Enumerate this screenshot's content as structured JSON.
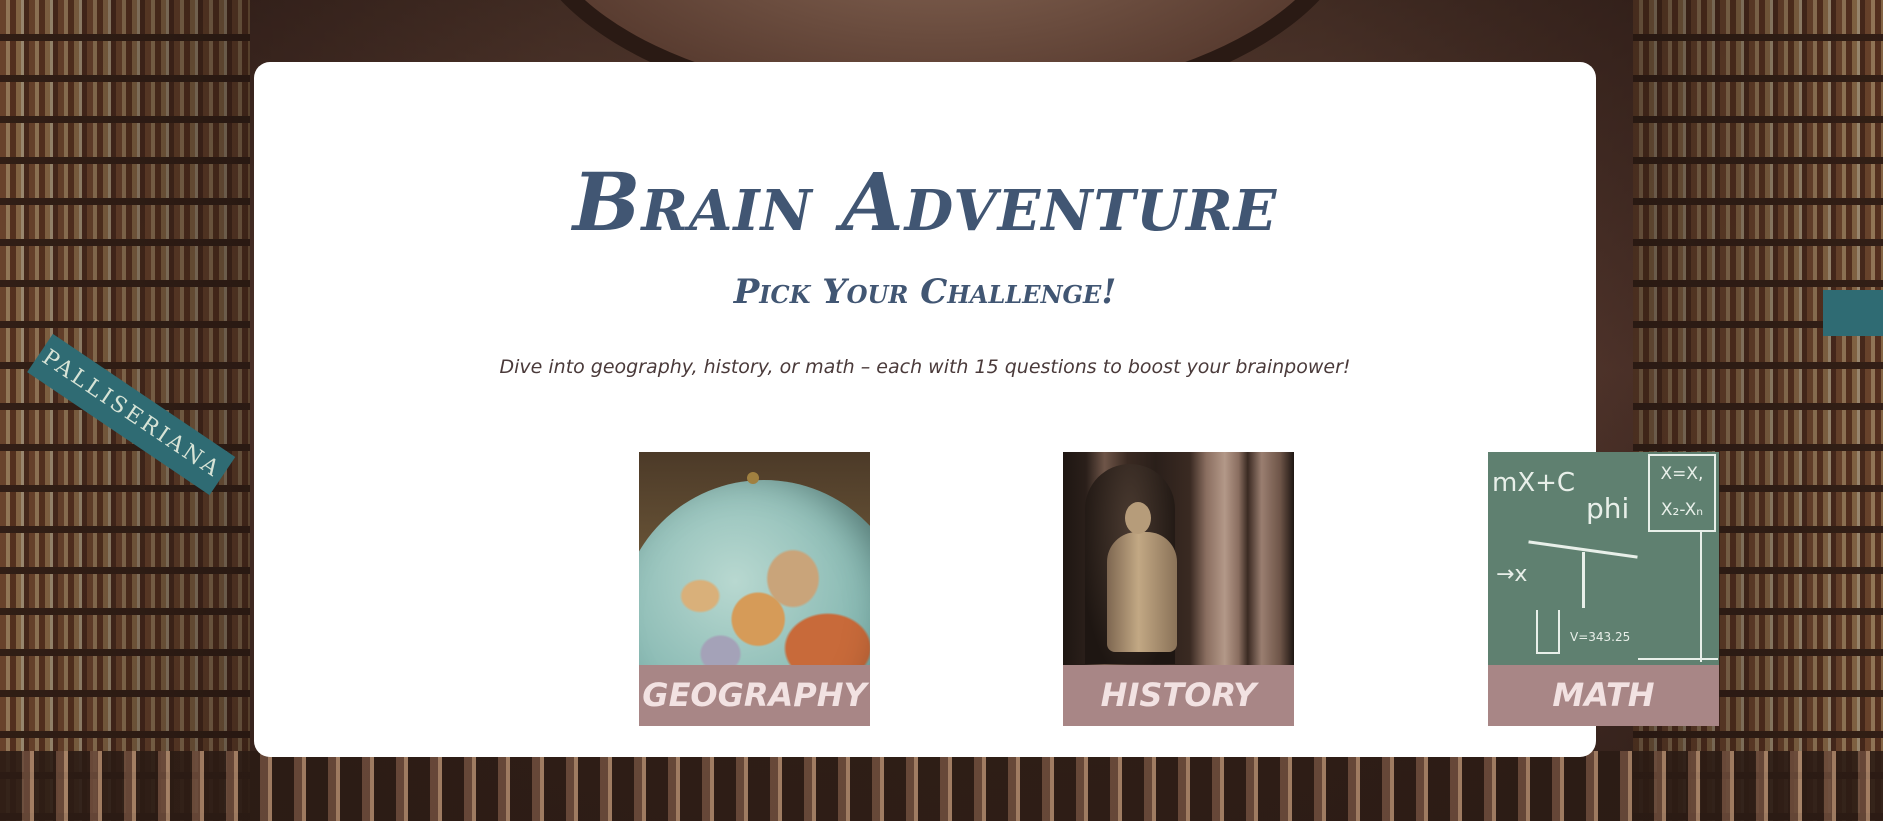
{
  "header": {
    "title": "Brain Adventure",
    "subtitle": "Pick Your Challenge!",
    "tagline": "Dive into geography, history, or math – each with 15 questions to boost your brainpower!"
  },
  "background": {
    "banner_text": "PALLISERIANA"
  },
  "categories": [
    {
      "label": "GEOGRAPHY",
      "image": "globe"
    },
    {
      "label": "HISTORY",
      "image": "statue"
    },
    {
      "label": "MATH",
      "image": "chalkboard"
    }
  ],
  "chalkboard": {
    "expr1": "mX+C",
    "expr2": "phi",
    "expr3": "→x",
    "expr4": "V=343.25",
    "box": "X=X, X₂-Xₙ"
  },
  "colors": {
    "title": "#415673",
    "label_bg": "#a88686",
    "label_text": "#f2e2e2",
    "card_bg": "#ffffff",
    "chalkboard": "#5f8070"
  }
}
